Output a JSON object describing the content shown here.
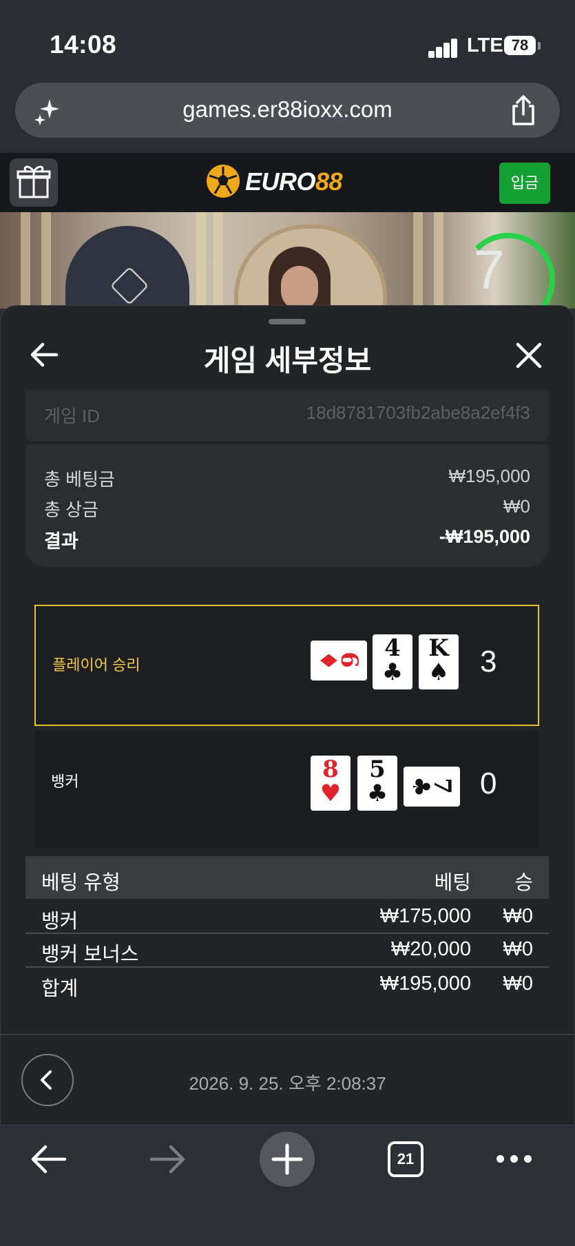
{
  "status_bar": {
    "time": "14:08",
    "network": "LTE",
    "battery": "78"
  },
  "browser": {
    "url": "games.er88ioxx.com",
    "tab_count": "21"
  },
  "site": {
    "logo_white": "EURO",
    "logo_yellow": "88",
    "deposit_label": "입금"
  },
  "video": {
    "countdown": "7"
  },
  "sheet": {
    "title": "게임 세부정보"
  },
  "game": {
    "id_label": "게임 ID",
    "id_value": "18d8781703fb2abe8a2ef4f3"
  },
  "summary": {
    "total_bet_label": "총 베팅금",
    "total_bet_value": "₩195,000",
    "total_win_label": "총 상금",
    "total_win_value": "₩0",
    "result_label": "결과",
    "result_value": "-₩195,000"
  },
  "hands": {
    "player": {
      "label": "플레이어 승리",
      "score": "3",
      "cards": [
        {
          "rank": "6",
          "suit": "♦",
          "color": "red"
        },
        {
          "rank": "4",
          "suit": "♣",
          "color": "black"
        },
        {
          "rank": "K",
          "suit": "♠",
          "color": "black"
        }
      ]
    },
    "banker": {
      "label": "뱅커",
      "score": "0",
      "cards": [
        {
          "rank": "8",
          "suit": "♥",
          "color": "red"
        },
        {
          "rank": "5",
          "suit": "♣",
          "color": "black"
        },
        {
          "rank": "7",
          "suit": "♣",
          "color": "black"
        }
      ]
    }
  },
  "bet_table": {
    "headers": {
      "type": "베팅 유형",
      "bet": "베팅",
      "win": "승"
    },
    "rows": [
      {
        "type": "뱅커",
        "bet": "₩175,000",
        "win": "₩0"
      },
      {
        "type": "뱅커 보너스",
        "bet": "₩20,000",
        "win": "₩0"
      },
      {
        "type": "합계",
        "bet": "₩195,000",
        "win": "₩0"
      }
    ]
  },
  "footer": {
    "timestamp": "2026. 9. 25. 오후 2:08:37"
  },
  "colors": {
    "accent_yellow": "#e6c32a",
    "deposit_green": "#14a032",
    "brand_orange": "#f0a81b"
  }
}
